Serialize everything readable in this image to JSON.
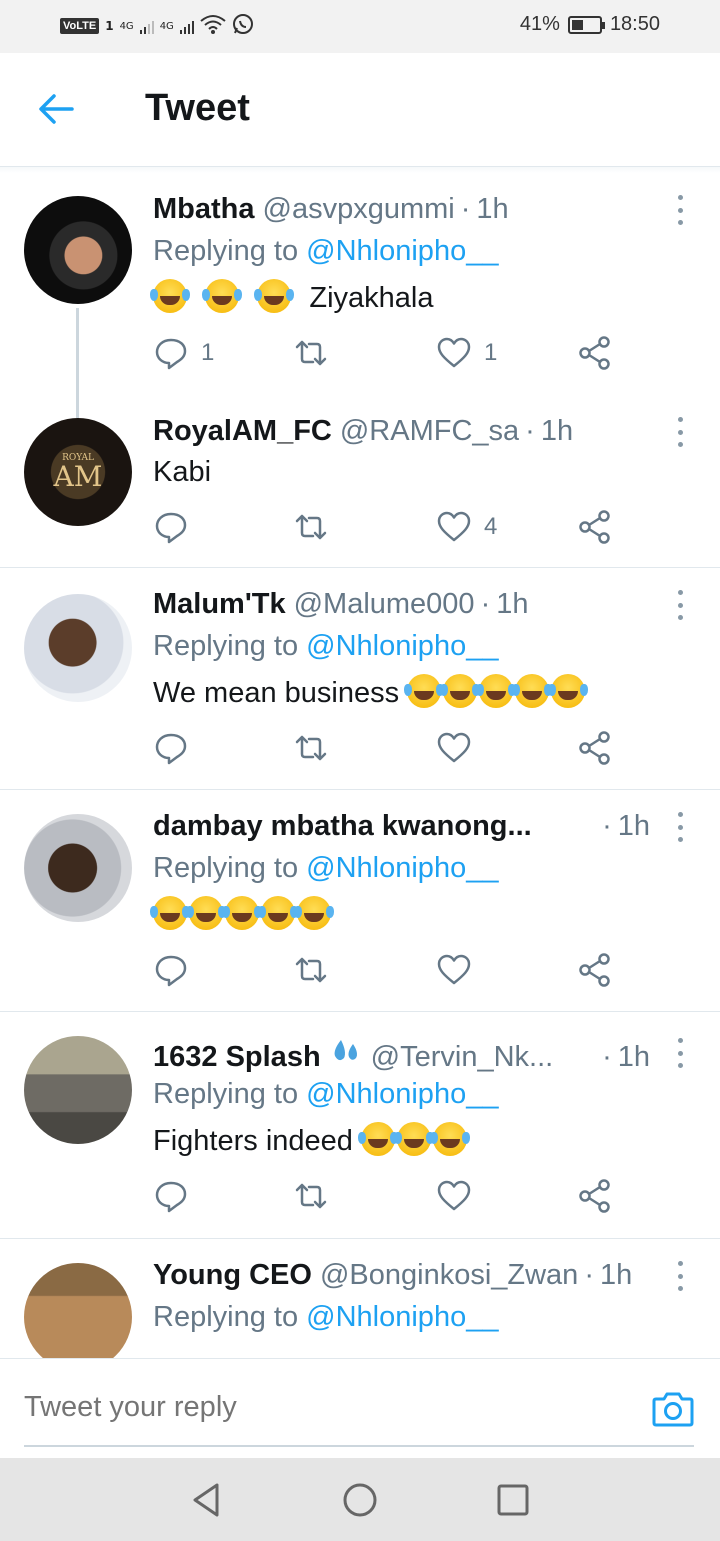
{
  "status_bar": {
    "volte": "VoLTE",
    "sim1": "1",
    "net1": "4G",
    "net2": "4G",
    "battery_percent": "41%",
    "battery_level": 0.41,
    "time": "18:50"
  },
  "header": {
    "title": "Tweet"
  },
  "tweets": [
    {
      "name": "Mbatha",
      "handle": "@asvpxgummi",
      "time": "1h",
      "replying_prefix": "Replying to ",
      "replying_to": "@Nhlonipho__",
      "text": "Ziyakhala",
      "emoji_count": 3,
      "replies": "1",
      "likes": "1"
    },
    {
      "name": "RoyalAM_FC",
      "handle": "@RAMFC_sa",
      "time": "1h",
      "text": "Kabi",
      "likes": "4",
      "avatar_text": "AM",
      "avatar_top": "ROYAL"
    },
    {
      "name": "Malum'Tk",
      "handle": "@Malume000",
      "time": "1h",
      "replying_prefix": "Replying to ",
      "replying_to": "@Nhlonipho__",
      "text": "We mean business"
    },
    {
      "name": "dambay mbatha kwanong...",
      "time": "1h",
      "replying_prefix": "Replying to ",
      "replying_to": "@Nhlonipho__"
    },
    {
      "name": "1632 Splash",
      "handle": "@Tervin_Nk...",
      "time": "1h",
      "replying_prefix": "Replying to ",
      "replying_to": "@Nhlonipho__",
      "text": "Fighters indeed"
    },
    {
      "name": "Young CEO",
      "handle": "@Bonginkosi_Zwan",
      "time": "1h",
      "replying_prefix": "Replying to ",
      "replying_to": "@Nhlonipho__"
    }
  ],
  "reply_bar": {
    "placeholder": "Tweet your reply"
  },
  "icons": {
    "back": "arrow-left-icon",
    "more": "more-vertical-icon",
    "reply": "comment-icon",
    "retweet": "retweet-icon",
    "like": "heart-icon",
    "share": "share-icon",
    "camera": "camera-icon",
    "nav_back": "triangle-back-icon",
    "nav_home": "circle-home-icon",
    "nav_recent": "square-recent-icon"
  },
  "colors": {
    "accent": "#1da1f2",
    "secondary_text": "#657786",
    "primary_text": "#14171a",
    "divider": "#e1e8ed"
  }
}
